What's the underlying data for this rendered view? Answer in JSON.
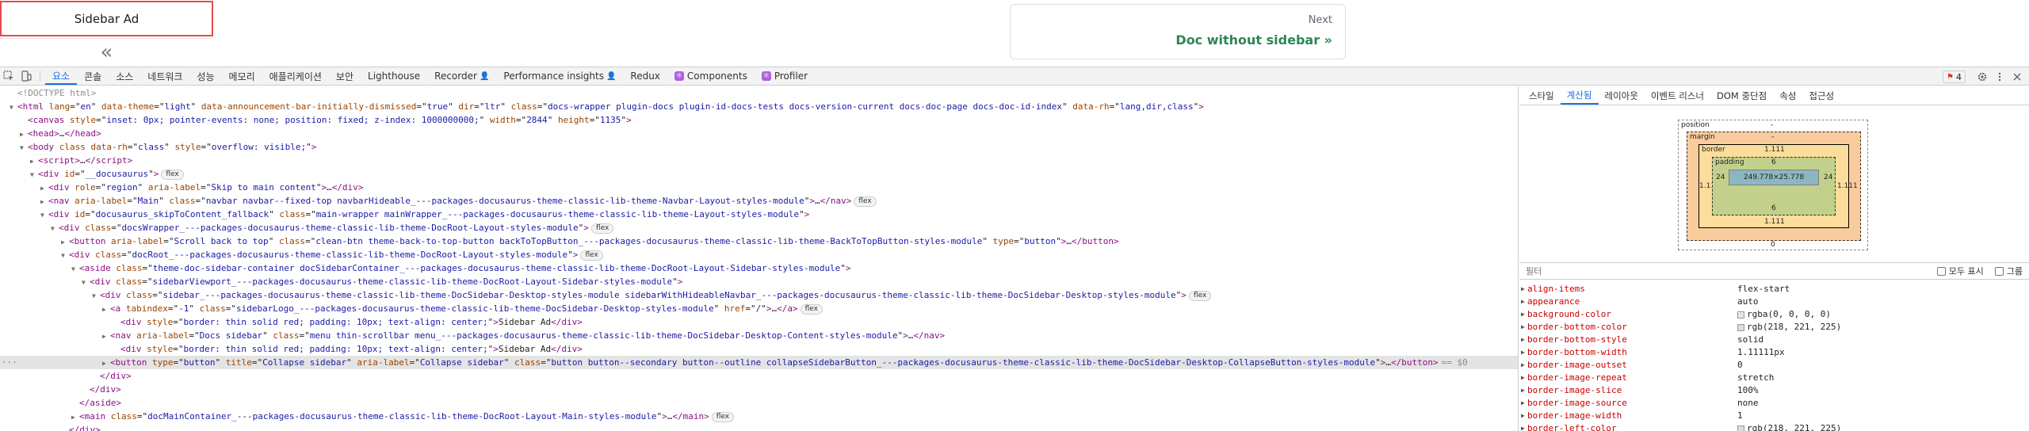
{
  "page": {
    "sidebar_ad": "Sidebar Ad",
    "collapse_glyph": "«",
    "pager_next_sub": "Next",
    "pager_next_label": "Doc without sidebar »"
  },
  "devtools": {
    "tabs": [
      {
        "label": "요소",
        "active": true
      },
      {
        "label": "콘솔"
      },
      {
        "label": "소스"
      },
      {
        "label": "네트워크"
      },
      {
        "label": "성능"
      },
      {
        "label": "메모리"
      },
      {
        "label": "애플리케이션"
      },
      {
        "label": "보안"
      },
      {
        "label": "Lighthouse"
      },
      {
        "label": "Recorder",
        "person": true
      },
      {
        "label": "Performance insights",
        "person": true
      },
      {
        "label": "Redux"
      },
      {
        "label": "Components",
        "ext": true
      },
      {
        "label": "Profiler",
        "ext": true
      }
    ],
    "issues_count": "4",
    "icons": {
      "inspect": "inspect-icon",
      "device": "device-toolbar-icon",
      "settings": "gear-icon",
      "more": "more-vert-icon",
      "close": "close-icon",
      "issue": "issue-flag-icon"
    }
  },
  "dom_lines": [
    {
      "indent": 0,
      "arrow": "",
      "html": "<span class='cmt'>&lt;!DOCTYPE html&gt;</span>"
    },
    {
      "indent": 0,
      "arrow": "▼",
      "html": "<span class='tag'>&lt;html</span> <span class='attr'>lang</span>=\"<span class='val'>en</span>\" <span class='attr'>data-theme</span>=\"<span class='val'>light</span>\" <span class='attr'>data-announcement-bar-initially-dismissed</span>=\"<span class='val'>true</span>\" <span class='attr'>dir</span>=\"<span class='val'>ltr</span>\" <span class='attr'>class</span>=\"<span class='val'>docs-wrapper plugin-docs plugin-id-docs-tests docs-version-current docs-doc-page docs-doc-id-index</span>\" <span class='attr'>data-rh</span>=\"<span class='val'>lang,dir,class</span>\"<span class='tag'>&gt;</span>"
    },
    {
      "indent": 1,
      "arrow": "",
      "html": "<span class='tag'>&lt;canvas</span> <span class='attr'>style</span>=\"<span class='val'>inset: 0px; pointer-events: none; position: fixed; z-index: 1000000000;</span>\" <span class='attr'>width</span>=\"<span class='val'>2844</span>\" <span class='attr'>height</span>=\"<span class='val'>1135</span>\"<span class='tag'>&gt;</span>"
    },
    {
      "indent": 1,
      "arrow": "▶",
      "html": "<span class='tag'>&lt;head&gt;</span><span class='txt'>…</span><span class='tag'>&lt;/head&gt;</span>"
    },
    {
      "indent": 1,
      "arrow": "▼",
      "html": "<span class='tag'>&lt;body</span> <span class='attr'>class</span> <span class='attr'>data-rh</span>=\"<span class='val'>class</span>\" <span class='attr'>style</span>=\"<span class='val'>overflow: visible;</span>\"<span class='tag'>&gt;</span>"
    },
    {
      "indent": 2,
      "arrow": "▶",
      "html": "<span class='tag'>&lt;script&gt;</span><span class='txt'>…</span><span class='tag'>&lt;/script&gt;</span>"
    },
    {
      "indent": 2,
      "arrow": "▼",
      "html": "<span class='tag'>&lt;div</span> <span class='attr'>id</span>=\"<span class='val'>__docusaurus</span>\"<span class='tag'>&gt;</span>",
      "pill": "flex"
    },
    {
      "indent": 3,
      "arrow": "▶",
      "html": "<span class='tag'>&lt;div</span> <span class='attr'>role</span>=\"<span class='val'>region</span>\" <span class='attr'>aria-label</span>=\"<span class='val'>Skip to main content</span>\"<span class='tag'>&gt;</span><span class='txt'>…</span><span class='tag'>&lt;/div&gt;</span>"
    },
    {
      "indent": 3,
      "arrow": "▶",
      "html": "<span class='tag'>&lt;nav</span> <span class='attr'>aria-label</span>=\"<span class='val'>Main</span>\" <span class='attr'>class</span>=\"<span class='val'>navbar navbar--fixed-top navbarHideable_---packages-docusaurus-theme-classic-lib-theme-Navbar-Layout-styles-module</span>\"<span class='tag'>&gt;</span><span class='txt'>…</span><span class='tag'>&lt;/nav&gt;</span>",
      "pill": "flex"
    },
    {
      "indent": 3,
      "arrow": "▼",
      "html": "<span class='tag'>&lt;div</span> <span class='attr'>id</span>=\"<span class='val'>docusaurus_skipToContent_fallback</span>\" <span class='attr'>class</span>=\"<span class='val'>main-wrapper mainWrapper_---packages-docusaurus-theme-classic-lib-theme-Layout-styles-module</span>\"<span class='tag'>&gt;</span>"
    },
    {
      "indent": 4,
      "arrow": "▼",
      "html": "<span class='tag'>&lt;div</span> <span class='attr'>class</span>=\"<span class='val'>docsWrapper_---packages-docusaurus-theme-classic-lib-theme-DocRoot-Layout-styles-module</span>\"<span class='tag'>&gt;</span>",
      "pill": "flex"
    },
    {
      "indent": 5,
      "arrow": "▶",
      "html": "<span class='tag'>&lt;button</span> <span class='attr'>aria-label</span>=\"<span class='val'>Scroll back to top</span>\" <span class='attr'>class</span>=\"<span class='val'>clean-btn theme-back-to-top-button backToTopButton_---packages-docusaurus-theme-classic-lib-theme-BackToTopButton-styles-module</span>\" <span class='attr'>type</span>=\"<span class='val'>button</span>\"<span class='tag'>&gt;</span><span class='txt'>…</span><span class='tag'>&lt;/button&gt;</span>"
    },
    {
      "indent": 5,
      "arrow": "▼",
      "html": "<span class='tag'>&lt;div</span> <span class='attr'>class</span>=\"<span class='val'>docRoot_---packages-docusaurus-theme-classic-lib-theme-DocRoot-Layout-styles-module</span>\"<span class='tag'>&gt;</span>",
      "pill": "flex"
    },
    {
      "indent": 6,
      "arrow": "▼",
      "html": "<span class='tag'>&lt;aside</span> <span class='attr'>class</span>=\"<span class='val'>theme-doc-sidebar-container docSidebarContainer_---packages-docusaurus-theme-classic-lib-theme-DocRoot-Layout-Sidebar-styles-module</span>\"<span class='tag'>&gt;</span>"
    },
    {
      "indent": 7,
      "arrow": "▼",
      "html": "<span class='tag'>&lt;div</span> <span class='attr'>class</span>=\"<span class='val'>sidebarViewport_---packages-docusaurus-theme-classic-lib-theme-DocRoot-Layout-Sidebar-styles-module</span>\"<span class='tag'>&gt;</span>"
    },
    {
      "indent": 8,
      "arrow": "▼",
      "html": "<span class='tag'>&lt;div</span> <span class='attr'>class</span>=\"<span class='val'>sidebar_---packages-docusaurus-theme-classic-lib-theme-DocSidebar-Desktop-styles-module sidebarWithHideableNavbar_---packages-docusaurus-theme-classic-lib-theme-DocSidebar-Desktop-styles-module</span>\"<span class='tag'>&gt;</span>",
      "pill": "flex"
    },
    {
      "indent": 9,
      "arrow": "▶",
      "html": "<span class='tag'>&lt;a</span> <span class='attr'>tabindex</span>=\"<span class='val'>-1</span>\" <span class='attr'>class</span>=\"<span class='val'>sidebarLogo_---packages-docusaurus-theme-classic-lib-theme-DocSidebar-Desktop-styles-module</span>\" <span class='attr'>href</span>=\"<span class='val'>/</span>\"<span class='tag'>&gt;</span><span class='txt'>…</span><span class='tag'>&lt;/a&gt;</span>",
      "pill": "flex"
    },
    {
      "indent": 10,
      "arrow": "",
      "html": "<span class='tag'>&lt;div</span> <span class='attr'>style</span>=\"<span class='val'>border: thin solid red; padding: 10px; text-align: center;</span>\"<span class='tag'>&gt;</span><span class='txt'>Sidebar Ad</span><span class='tag'>&lt;/div&gt;</span>"
    },
    {
      "indent": 9,
      "arrow": "▶",
      "html": "<span class='tag'>&lt;nav</span> <span class='attr'>aria-label</span>=\"<span class='val'>Docs sidebar</span>\" <span class='attr'>class</span>=\"<span class='val'>menu thin-scrollbar menu_---packages-docusaurus-theme-classic-lib-theme-DocSidebar-Desktop-Content-styles-module</span>\"<span class='tag'>&gt;</span><span class='txt'>…</span><span class='tag'>&lt;/nav&gt;</span>"
    },
    {
      "indent": 10,
      "arrow": "",
      "html": "<span class='tag'>&lt;div</span> <span class='attr'>style</span>=\"<span class='val'>border: thin solid red; padding: 10px; text-align: center;</span>\"<span class='tag'>&gt;</span><span class='txt'>Sidebar Ad</span><span class='tag'>&lt;/div&gt;</span>"
    },
    {
      "indent": 9,
      "arrow": "▶",
      "html": "<span class='tag'>&lt;button</span> <span class='attr'>type</span>=\"<span class='val'>button</span>\" <span class='attr'>title</span>=\"<span class='val'>Collapse sidebar</span>\" <span class='attr'>aria-label</span>=\"<span class='val'>Collapse sidebar</span>\" <span class='attr'>class</span>=\"<span class='val'>button button--secondary button--outline collapseSidebarButton_---packages-docusaurus-theme-classic-lib-theme-DocSidebar-Desktop-CollapseButton-styles-module</span>\"<span class='tag'>&gt;</span><span class='txt'>…</span><span class='tag'>&lt;/button&gt;</span><span class='dollar'>== $0</span>",
      "selected": true
    },
    {
      "indent": 8,
      "arrow": "",
      "html": "<span class='tag'>&lt;/div&gt;</span>"
    },
    {
      "indent": 7,
      "arrow": "",
      "html": "<span class='tag'>&lt;/div&gt;</span>"
    },
    {
      "indent": 6,
      "arrow": "",
      "html": "<span class='tag'>&lt;/aside&gt;</span>"
    },
    {
      "indent": 6,
      "arrow": "▶",
      "html": "<span class='tag'>&lt;main</span> <span class='attr'>class</span>=\"<span class='val'>docMainContainer_---packages-docusaurus-theme-classic-lib-theme-DocRoot-Layout-Main-styles-module</span>\"<span class='tag'>&gt;</span><span class='txt'>…</span><span class='tag'>&lt;/main&gt;</span>",
      "pill": "flex"
    },
    {
      "indent": 5,
      "arrow": "",
      "html": "<span class='tag'>&lt;/div&gt;</span>"
    }
  ],
  "side": {
    "tabs": [
      {
        "label": "스타일"
      },
      {
        "label": "계산됨",
        "active": true
      },
      {
        "label": "레이아웃"
      },
      {
        "label": "이벤트 리스너"
      },
      {
        "label": "DOM 중단점"
      },
      {
        "label": "속성"
      },
      {
        "label": "접근성"
      }
    ],
    "boxmodel": {
      "position_label": "position",
      "position_val": "-",
      "margin_label": "margin",
      "margin_val": "-",
      "border_label": "border",
      "border_val": "1.111",
      "padding_label": "padding",
      "padding_top": "6",
      "padding_side": "24",
      "content": "249.778×25.778",
      "bottom_zero": "0"
    },
    "filter_placeholder": "필터",
    "show_all_label": "모두 표시",
    "group_label": "그룹",
    "props": [
      {
        "name": "align-items",
        "value": "flex-start"
      },
      {
        "name": "appearance",
        "value": "auto"
      },
      {
        "name": "background-color",
        "value": "rgba(0, 0, 0, 0)",
        "swatch": "transparent"
      },
      {
        "name": "border-bottom-color",
        "value": "rgb(218, 221, 225)",
        "swatch": "#dadde1"
      },
      {
        "name": "border-bottom-style",
        "value": "solid"
      },
      {
        "name": "border-bottom-width",
        "value": "1.11111px"
      },
      {
        "name": "border-image-outset",
        "value": "0"
      },
      {
        "name": "border-image-repeat",
        "value": "stretch"
      },
      {
        "name": "border-image-slice",
        "value": "100%"
      },
      {
        "name": "border-image-source",
        "value": "none"
      },
      {
        "name": "border-image-width",
        "value": "1"
      },
      {
        "name": "border-left-color",
        "value": "rgb(218, 221, 225)",
        "swatch": "#dadde1"
      }
    ]
  }
}
